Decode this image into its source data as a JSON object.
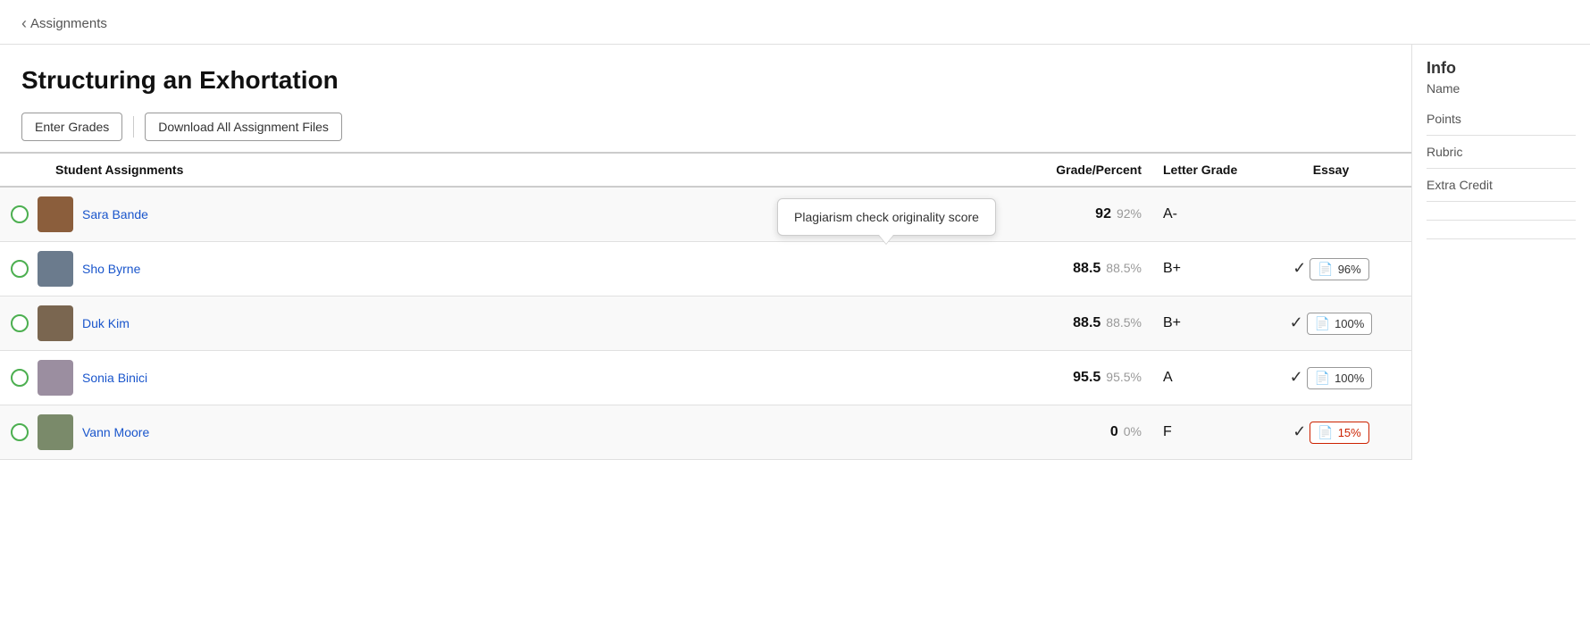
{
  "nav": {
    "back_label": "Assignments",
    "back_chevron": "‹"
  },
  "page": {
    "title": "Structuring an Exhortation"
  },
  "toolbar": {
    "enter_grades_label": "Enter Grades",
    "download_label": "Download All Assignment Files"
  },
  "info_panel": {
    "title": "Info",
    "subtitle": "Name",
    "col1": "Points",
    "col2": "Rubric",
    "col3": "Extra Credit"
  },
  "table": {
    "headers": {
      "student": "Student Assignments",
      "grade": "Grade/Percent",
      "letter": "Letter Grade",
      "essay": "Essay"
    },
    "rows": [
      {
        "id": "sara",
        "name": "Sara Bande",
        "grade_main": "92",
        "grade_pct": "92%",
        "letter": "A-",
        "has_check": false,
        "score": "",
        "score_color": "normal",
        "avatar_class": "avatar-sara",
        "avatar_text": ""
      },
      {
        "id": "sho",
        "name": "Sho Byrne",
        "grade_main": "88.5",
        "grade_pct": "88.5%",
        "letter": "B+",
        "has_check": true,
        "score": "96%",
        "score_color": "normal",
        "avatar_class": "avatar-sho",
        "avatar_text": ""
      },
      {
        "id": "duk",
        "name": "Duk Kim",
        "grade_main": "88.5",
        "grade_pct": "88.5%",
        "letter": "B+",
        "has_check": true,
        "score": "100%",
        "score_color": "normal",
        "avatar_class": "avatar-duk",
        "avatar_text": ""
      },
      {
        "id": "sonia",
        "name": "Sonia Binici",
        "grade_main": "95.5",
        "grade_pct": "95.5%",
        "letter": "A",
        "has_check": true,
        "score": "100%",
        "score_color": "normal",
        "avatar_class": "avatar-sonia",
        "avatar_text": ""
      },
      {
        "id": "vann",
        "name": "Vann Moore",
        "grade_main": "0",
        "grade_pct": "0%",
        "letter": "F",
        "has_check": true,
        "score": "15%",
        "score_color": "red",
        "avatar_class": "avatar-vann",
        "avatar_text": ""
      }
    ]
  },
  "tooltip": {
    "text": "Plagiarism check originality score"
  }
}
